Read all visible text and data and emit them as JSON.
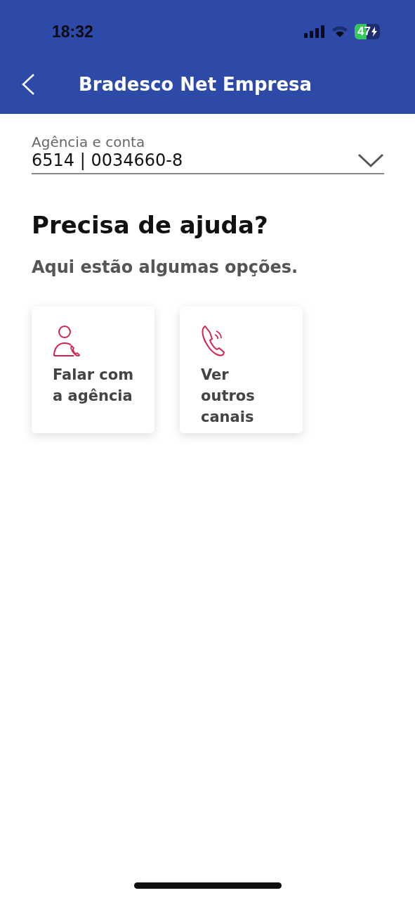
{
  "status_bar": {
    "time": "18:32",
    "battery": "47"
  },
  "header": {
    "title": "Bradesco Net Empresa"
  },
  "account": {
    "label": "Agência e conta",
    "value": "6514 | 0034660-8"
  },
  "heading": "Precisa de ajuda?",
  "subheading": "Aqui estão algumas opções.",
  "options": [
    {
      "kind": "agency",
      "label": "Falar com a agência"
    },
    {
      "kind": "channels",
      "label": "Ver outros canais"
    }
  ]
}
